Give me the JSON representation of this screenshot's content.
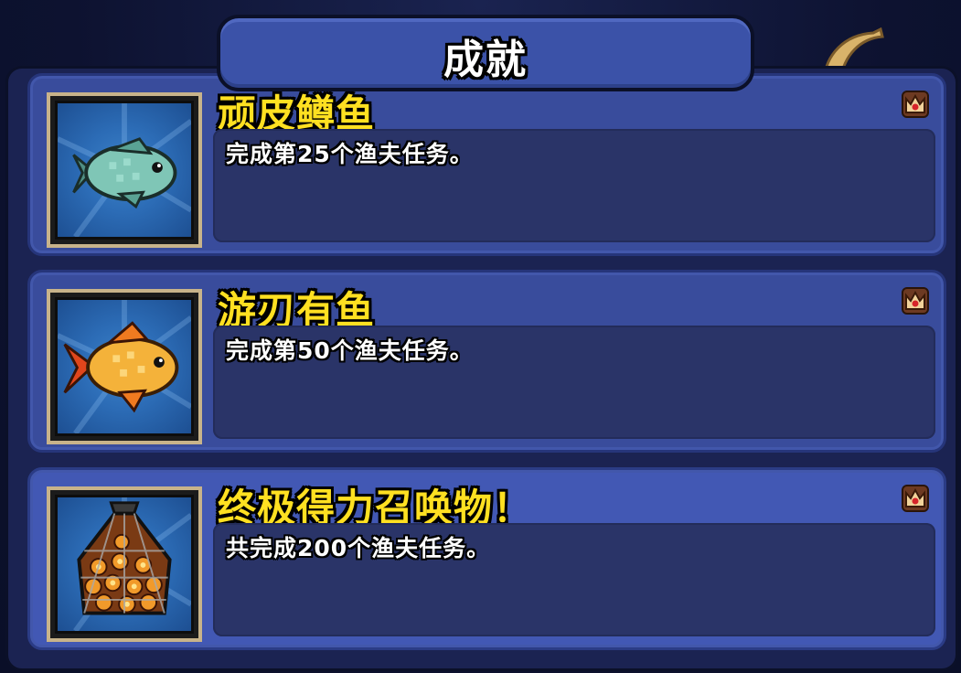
{
  "header": {
    "title": "成就"
  },
  "achievements": [
    {
      "name": "顽皮鳟鱼",
      "description": "完成第25个渔夫任务。",
      "icon": "green-fish-icon",
      "badge": "crown-icon"
    },
    {
      "name": "游刃有鱼",
      "description": "完成第50个渔夫任务。",
      "icon": "golden-fish-icon",
      "badge": "crown-icon"
    },
    {
      "name": "终极得力召唤物！",
      "description": "共完成200个渔夫任务。",
      "icon": "fish-net-icon",
      "badge": "crown-icon"
    }
  ],
  "colors": {
    "title_tab": "#3b52a8",
    "entry_bg": "#394c9c",
    "name_text": "#ffe021",
    "desc_box": "#2a3468"
  }
}
